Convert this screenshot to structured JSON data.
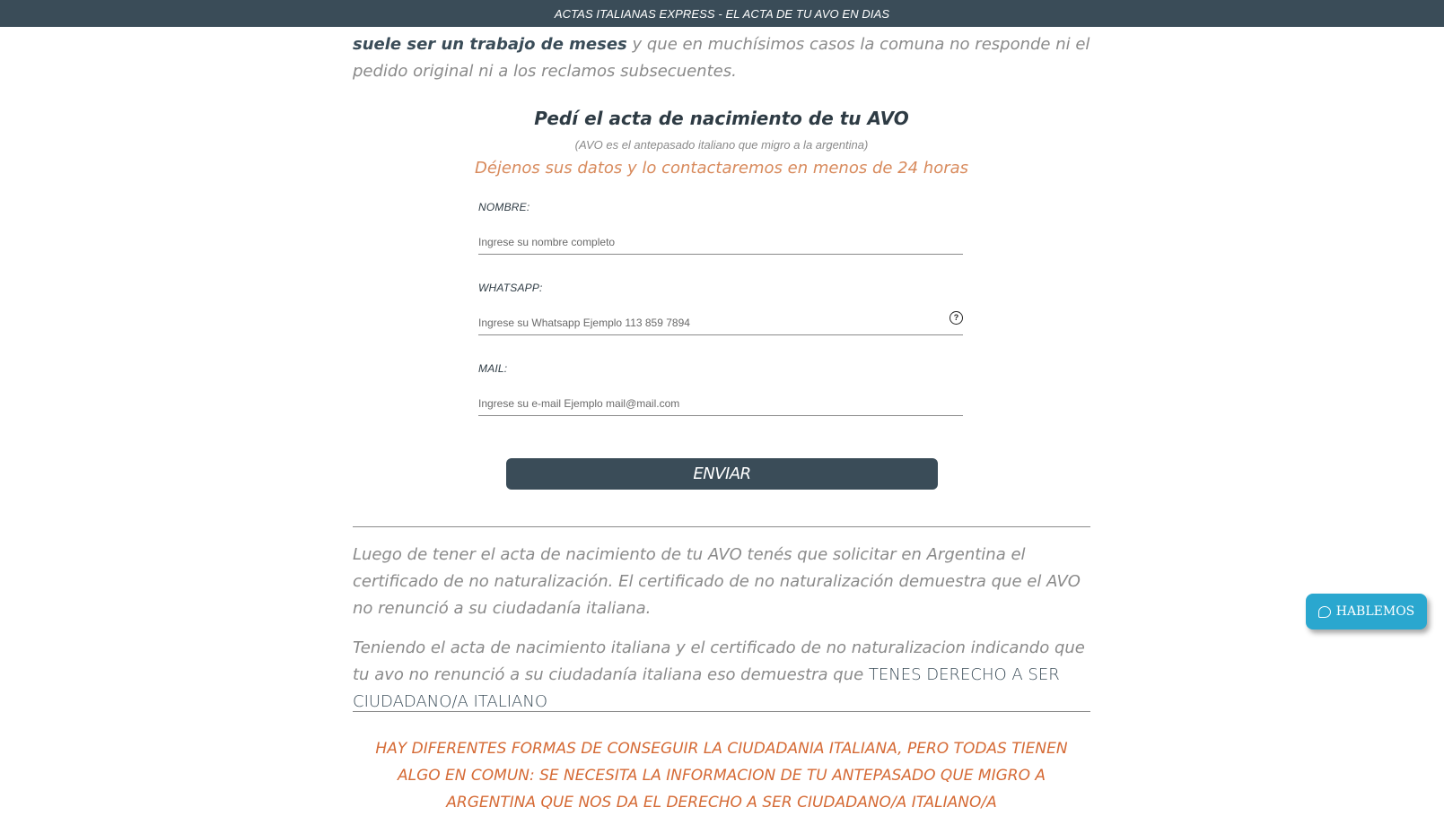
{
  "topbar": {
    "text": "ACTAS ITALIANAS EXPRESS - EL ACTA DE TU AVO EN DIAS"
  },
  "intro": {
    "bold": "suele ser un trabajo de meses",
    "rest": " y que en muchísimos casos la comuna no responde ni el pedido original ni a los reclamos subsecuentes."
  },
  "form": {
    "title": "Pedí el acta de nacimiento de tu AVO",
    "note": "(AVO es el antepasado italiano que migro a la argentina)",
    "cta": "Déjenos sus datos y lo contactaremos en menos de 24 horas",
    "fields": [
      {
        "label": "NOMBRE:",
        "placeholder": "Ingrese su nombre completo"
      },
      {
        "label": "WHATSAPP:",
        "placeholder": "Ingrese su Whatsapp Ejemplo 113 859 7894"
      },
      {
        "label": "MAIL:",
        "placeholder": "Ingrese su e-mail Ejemplo mail@mail.com"
      }
    ],
    "help_icon": "?",
    "submit_label": "ENVIAR"
  },
  "info": {
    "para1": "Luego de tener el acta de nacimiento de tu AVO tenés que solicitar en Argentina el certificado de no naturalización. El certificado de no naturalización demuestra que el AVO no renunció a su ciudadanía italiana.",
    "para2_text": "Teniendo el acta de nacimiento italiana y el certificado de no naturalizacion indicando que tu avo no renunció a su ciudadanía italiana eso demuestra que ",
    "para2_emph": "TENES DERECHO A SER CIUDADANO/A ITALIANO",
    "headline": "HAY DIFERENTES FORMAS DE CONSEGUIR LA CIUDADANIA ITALIANA, PERO TODAS TIENEN ALGO EN COMUN: SE NECESITA LA INFORMACION DE TU ANTEPASADO QUE MIGRO A ARGENTINA QUE NOS DA EL DERECHO A SER CIUDADANO/A ITALIANO/A"
  },
  "chat": {
    "label": "HABLEMOS",
    "icon": "chat-bubble-icon"
  },
  "colors": {
    "primary": "#3a4c58",
    "accent_orange": "#d56a35",
    "accent_peach": "#d88a5c",
    "chat_blue": "#2aa7cf",
    "text_gray": "#8a8a8a"
  }
}
